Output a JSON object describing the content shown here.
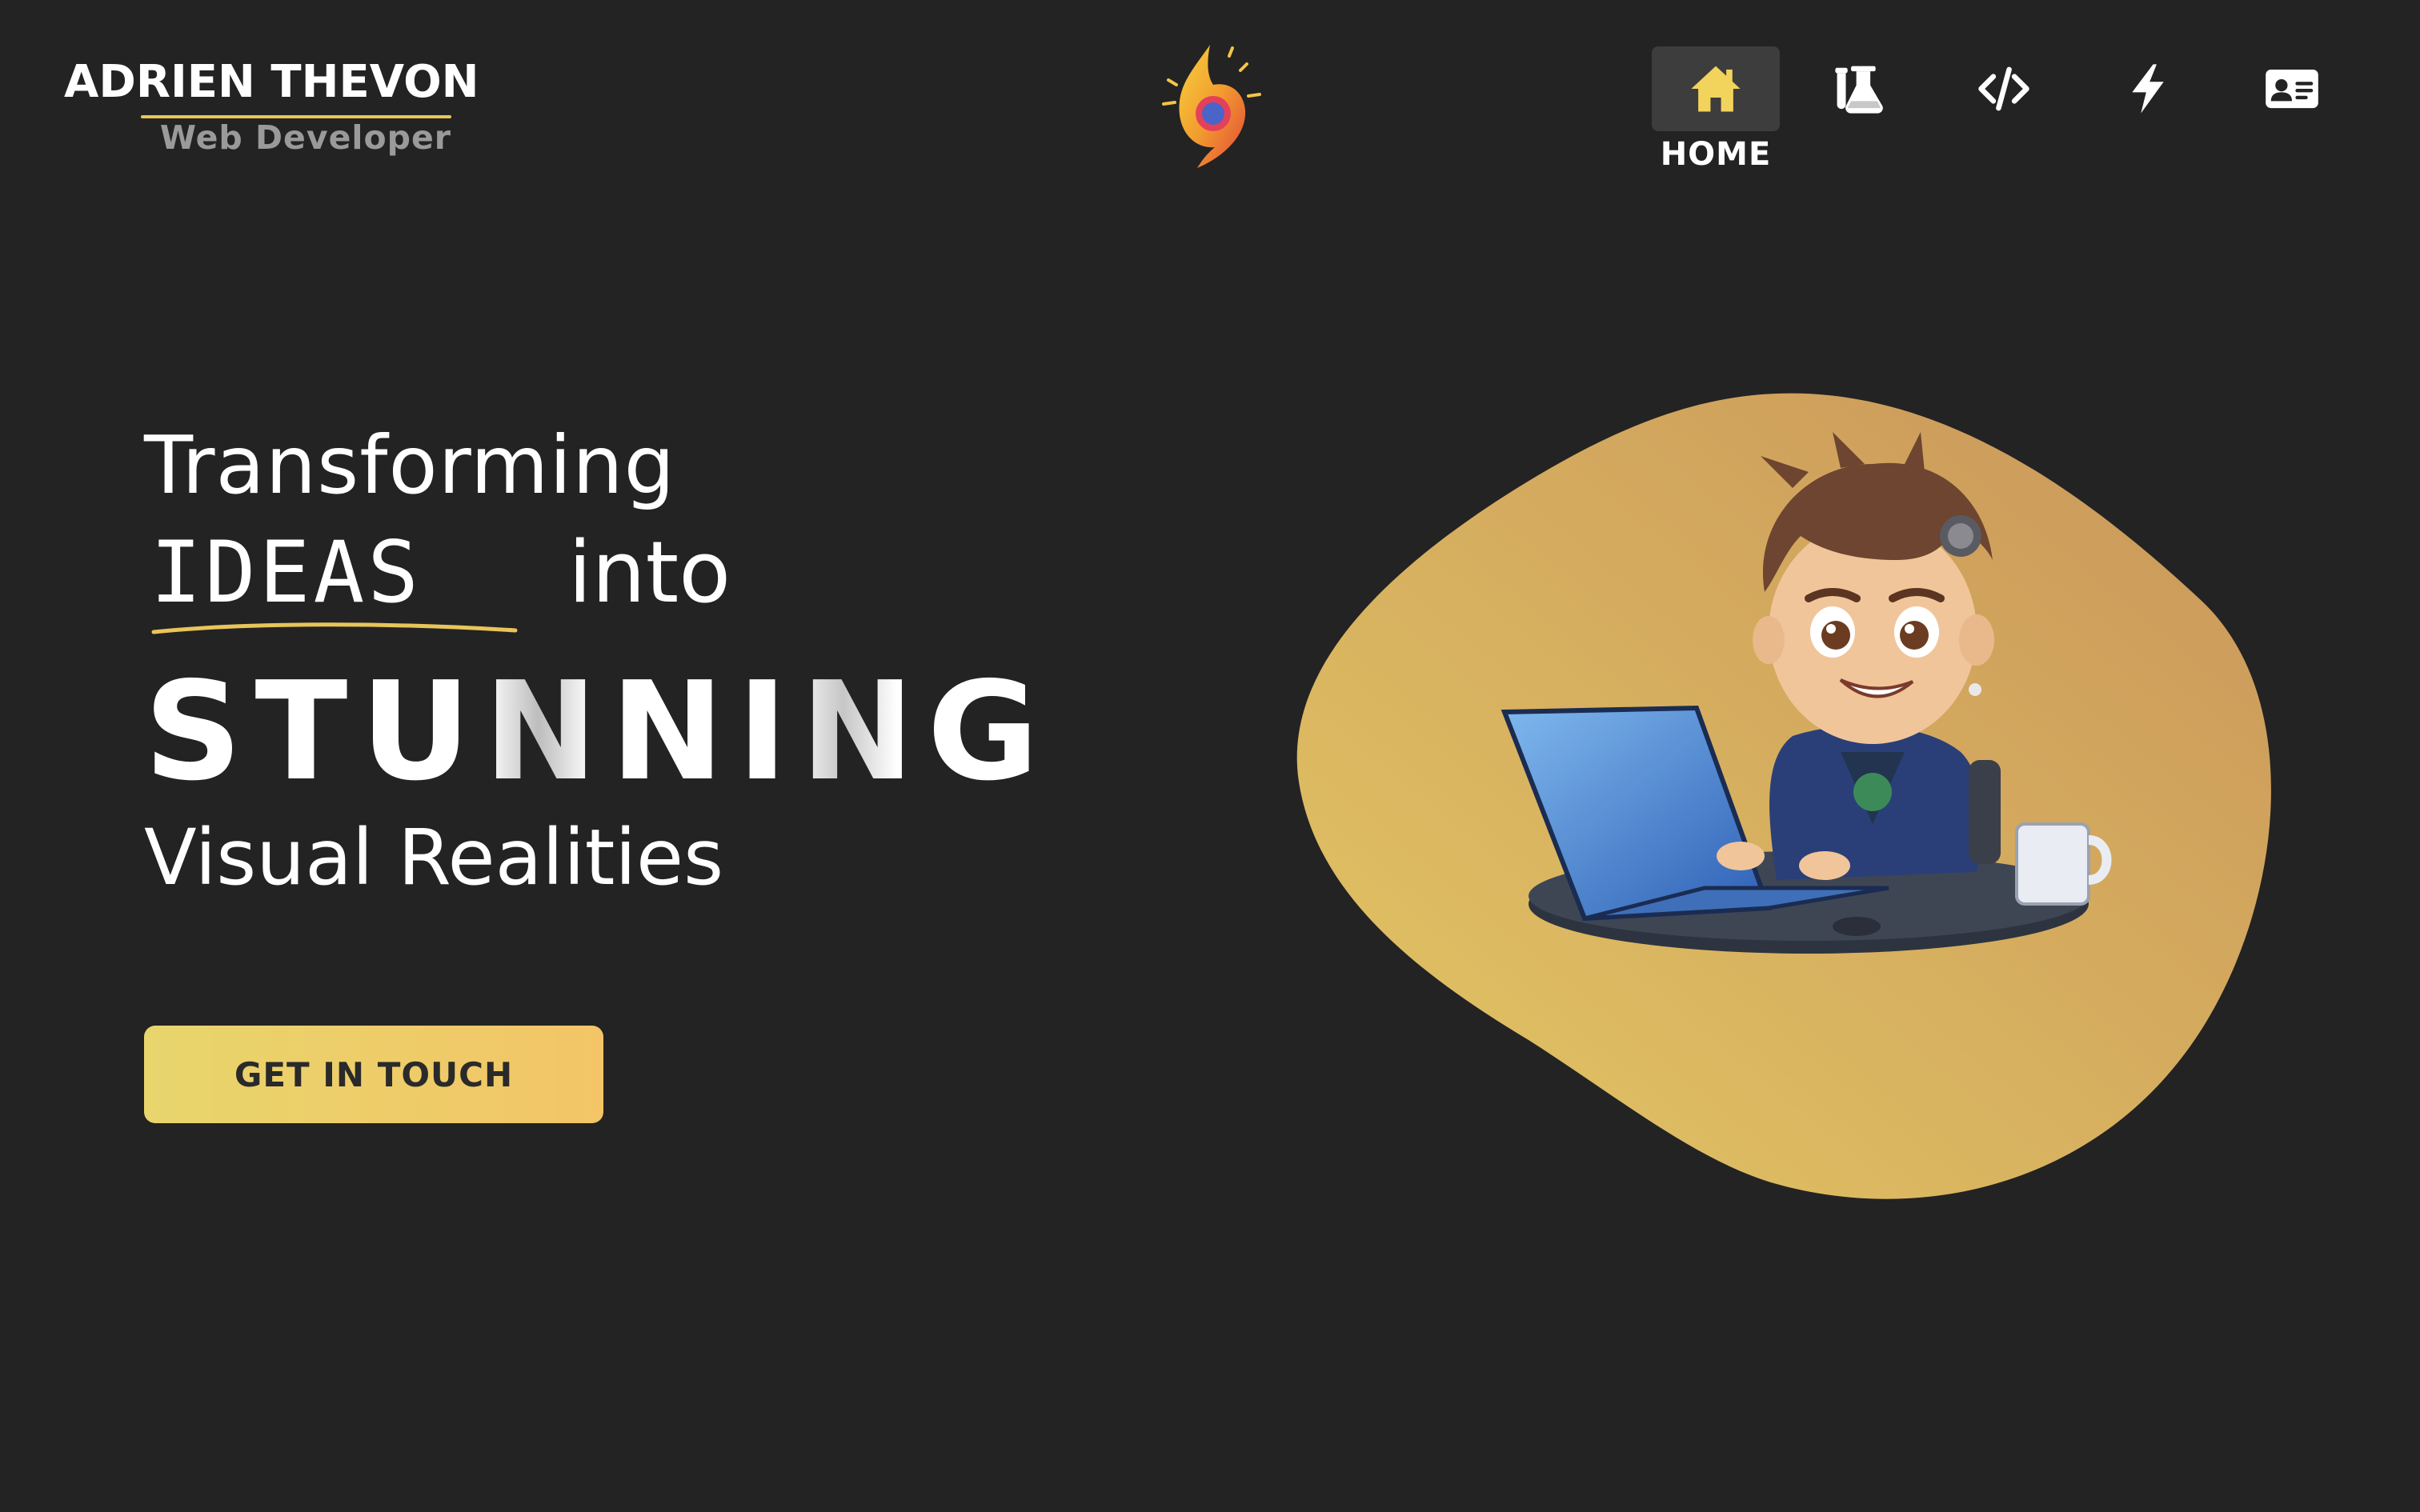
{
  "brand": {
    "name": "ADRIEN THEVON",
    "role": "Web Developer"
  },
  "logo": {
    "icon": "flame-logo-icon"
  },
  "nav": {
    "items": [
      {
        "icon": "home-icon",
        "label": "HOME",
        "active": true
      },
      {
        "icon": "flask-icon",
        "label": "",
        "active": false
      },
      {
        "icon": "code-icon",
        "label": "",
        "active": false
      },
      {
        "icon": "lightning-icon",
        "label": "",
        "active": false
      },
      {
        "icon": "id-card-icon",
        "label": "",
        "active": false
      }
    ]
  },
  "hero": {
    "line1": "Transforming",
    "line2_highlight": "IDEAS",
    "line2_rest": "into",
    "line3": "STUNNING",
    "line4": "Visual Realities"
  },
  "cta": {
    "label": "GET IN TOUCH"
  },
  "illustration": {
    "subject": "developer-avatar-with-laptop"
  },
  "colors": {
    "background": "#232323",
    "accent": "#e8c55a",
    "nav_active_bg": "#3d3d3d",
    "home_icon": "#f2d35c",
    "blob_start": "#e3c764",
    "blob_end": "#c9955a"
  }
}
